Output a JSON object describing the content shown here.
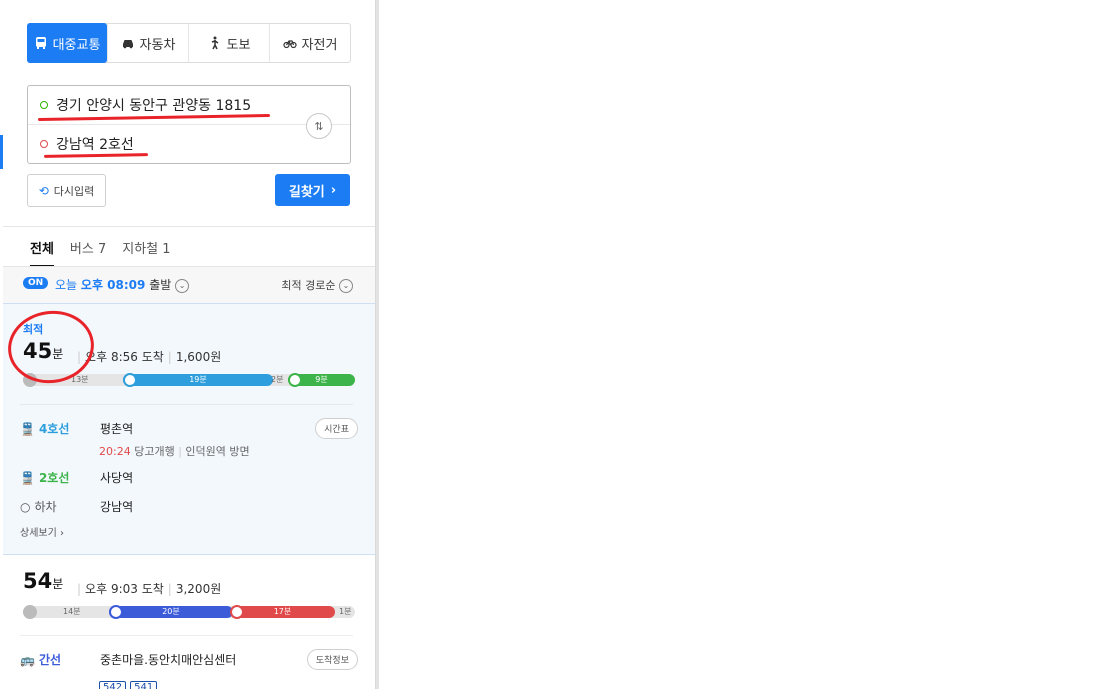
{
  "mode_tabs": [
    {
      "label": "대중교통",
      "icon": "bus-icon"
    },
    {
      "label": "자동차",
      "icon": "car-icon"
    },
    {
      "label": "도보",
      "icon": "walk-icon"
    },
    {
      "label": "자전거",
      "icon": "bicycle-icon"
    }
  ],
  "route": {
    "start": "경기 안양시 동안구 관양동 1815",
    "end": "강남역 2호선"
  },
  "buttons": {
    "reset": "다시입력",
    "search": "길찾기"
  },
  "result_tabs": [
    "전체",
    "버스 7",
    "지하철 1"
  ],
  "filter": {
    "on_badge": "ON",
    "today": "오늘",
    "time": "오후 08:09",
    "depart_suffix": "출발",
    "sort": "최적 경로순"
  },
  "routes": [
    {
      "badge": "최적",
      "duration_num": "45",
      "duration_unit": "분",
      "arrive": "오후 8:56 도착",
      "fare": "1,600원",
      "segments": {
        "walk1": "13분",
        "subway1": "19분",
        "walk2": "2분",
        "subway2": "9분"
      },
      "steps": [
        {
          "line": "4호선",
          "station": "평촌역",
          "button": "시간표"
        },
        {
          "line": "2호선",
          "station": "사당역"
        },
        {
          "line": "하차",
          "station": "강남역"
        }
      ],
      "sub_time": "20:24",
      "sub_info": "당고개행",
      "sub_dir": "인덕원역 방면",
      "detail": "상세보기"
    },
    {
      "duration_num": "54",
      "duration_unit": "분",
      "arrive": "오후 9:03 도착",
      "fare": "3,200원",
      "segments": {
        "walk1": "14분",
        "bus1": "20분",
        "bus2": "17분",
        "walk2": "1분"
      },
      "steps": [
        {
          "line": "간선",
          "station": "중촌마을.동안치매안심센터",
          "button": "도착정보",
          "buses": [
            "542",
            "541"
          ]
        }
      ]
    }
  ],
  "colors": {
    "accent": "#1c7cf4",
    "line4": "#2e9fdc",
    "line2": "#3cb44a",
    "bus_blue": "#3c5bd8",
    "bus_red": "#e04a4a"
  }
}
